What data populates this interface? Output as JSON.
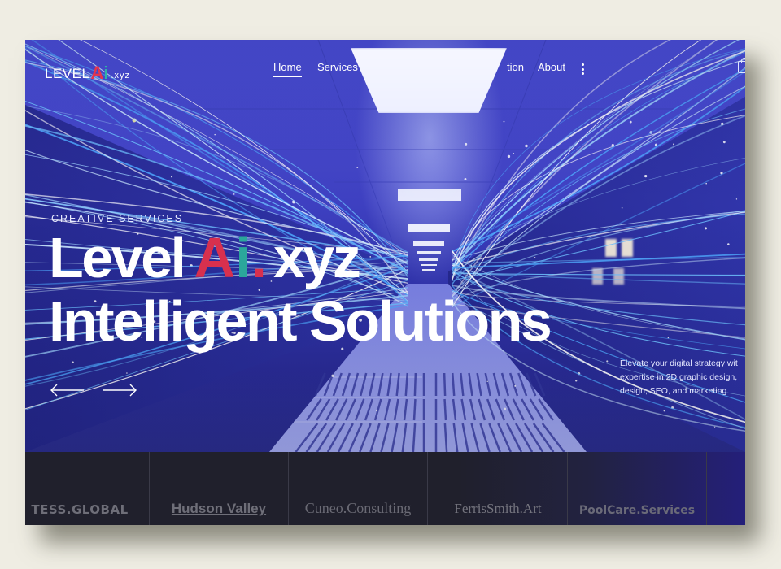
{
  "brand": {
    "logo_prefix": "LEVEL",
    "logo_a": "A",
    "logo_i": "i",
    "logo_suffix": ".xyz",
    "colors": {
      "accent_red": "#d8304e",
      "accent_teal": "#2ba79b",
      "hero_blue": "#4446c9",
      "strip_dark": "#20202c"
    }
  },
  "nav": {
    "items": [
      {
        "label": "Home",
        "active": true
      },
      {
        "label": "Services",
        "active": false
      },
      {
        "label": "tion",
        "active": false
      },
      {
        "label": "About",
        "active": false
      }
    ],
    "more_icon": "kebab-menu-icon",
    "cart_icon": "shopping-bag-icon"
  },
  "hero": {
    "kicker": "CREATIVE SERVICES",
    "title_line1_prefix": "Level",
    "title_line1_a": "A",
    "title_line1_i": "i",
    "title_line1_dot": ".",
    "title_line1_suffix": "xyz",
    "title_line2": "Intelligent Solutions",
    "description": [
      "Elevate your digital strategy wit",
      "expertise in 2D graphic design,",
      "design, SEO, and marketing."
    ],
    "prev_icon": "arrow-left-icon",
    "next_icon": "arrow-right-icon"
  },
  "clients": [
    "TESS.GLOBAL",
    "Hudson Valley",
    "Cuneo.Consulting",
    "FerrisSmith.Art",
    "PoolCare.Services",
    ""
  ]
}
